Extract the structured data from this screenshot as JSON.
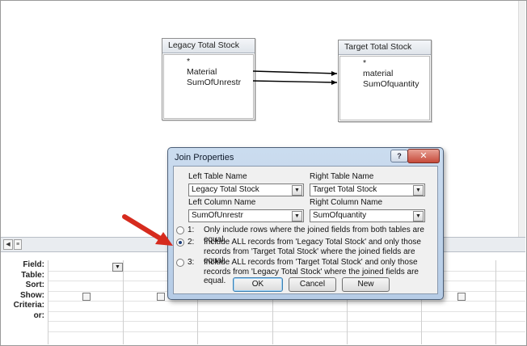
{
  "tables": {
    "left": {
      "title": "Legacy Total Stock",
      "fields": [
        "*",
        "Material",
        "SumOfUnrestr"
      ]
    },
    "right": {
      "title": "Target Total Stock",
      "fields": [
        "*",
        "material",
        "SumOfquantity"
      ]
    }
  },
  "grid": {
    "row_labels": [
      "Field:",
      "Table:",
      "Sort:",
      "Show:",
      "Criteria:",
      "or:"
    ]
  },
  "dialog": {
    "title": "Join Properties",
    "help_label": "?",
    "close_label": "✕",
    "left_table_label": "Left Table Name",
    "left_table_value": "Legacy Total Stock",
    "right_table_label": "Right Table Name",
    "right_table_value": "Target Total Stock",
    "left_column_label": "Left Column Name",
    "left_column_value": "SumOfUnrestr",
    "right_column_label": "Right Column Name",
    "right_column_value": "SumOfquantity",
    "options": [
      {
        "num": "1:",
        "text": "Only include rows where the joined fields from both tables are equal.",
        "selected": false
      },
      {
        "num": "2:",
        "text": "Include ALL records from 'Legacy Total Stock' and only those records from 'Target Total Stock' where the joined fields are equal.",
        "selected": true
      },
      {
        "num": "3:",
        "text": "Include ALL records from 'Target Total Stock' and only those records from 'Legacy Total Stock' where the joined fields are equal.",
        "selected": false
      }
    ],
    "ok_label": "OK",
    "cancel_label": "Cancel",
    "new_label": "New"
  },
  "colors": {
    "annotation_arrow": "#d62b1e",
    "dialog_frame": "#b6cce6"
  }
}
